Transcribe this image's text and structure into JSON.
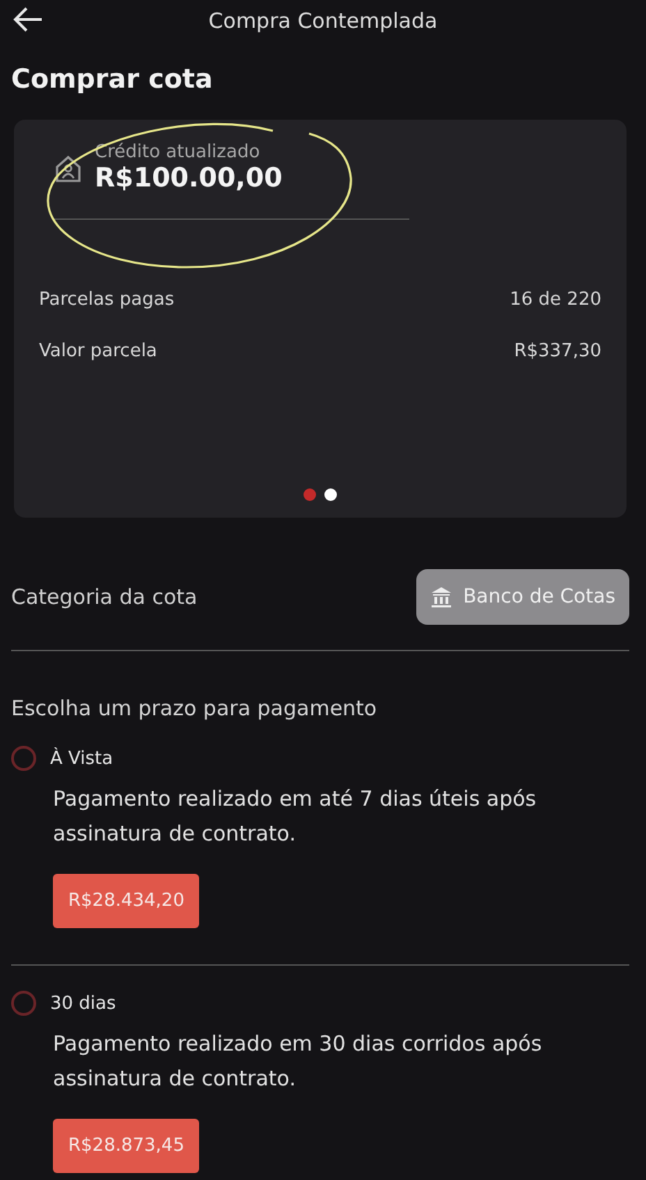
{
  "header": {
    "title": "Compra Contemplada"
  },
  "page_title": "Comprar cota",
  "card": {
    "credit_label": "Crédito atualizado",
    "credit_value": "R$100.00,00",
    "rows": [
      {
        "label": "Parcelas pagas",
        "value": "16 de 220"
      },
      {
        "label": "Valor parcela",
        "value": "R$337,30"
      }
    ],
    "pages": [
      {
        "selected": true
      },
      {
        "selected": false
      }
    ]
  },
  "category": {
    "label": "Categoria da cota",
    "button": "Banco de Cotas"
  },
  "payment": {
    "title": "Escolha um prazo para pagamento",
    "options": [
      {
        "label": "À Vista",
        "selected": false,
        "description": "Pagamento realizado em até 7 dias úteis após assinatura de contrato.",
        "price": "R$28.434,20"
      },
      {
        "label": "30 dias",
        "selected": false,
        "description": "Pagamento realizado em 30 dias corridos após assinatura de contrato.",
        "price": "R$28.873,45"
      }
    ]
  }
}
